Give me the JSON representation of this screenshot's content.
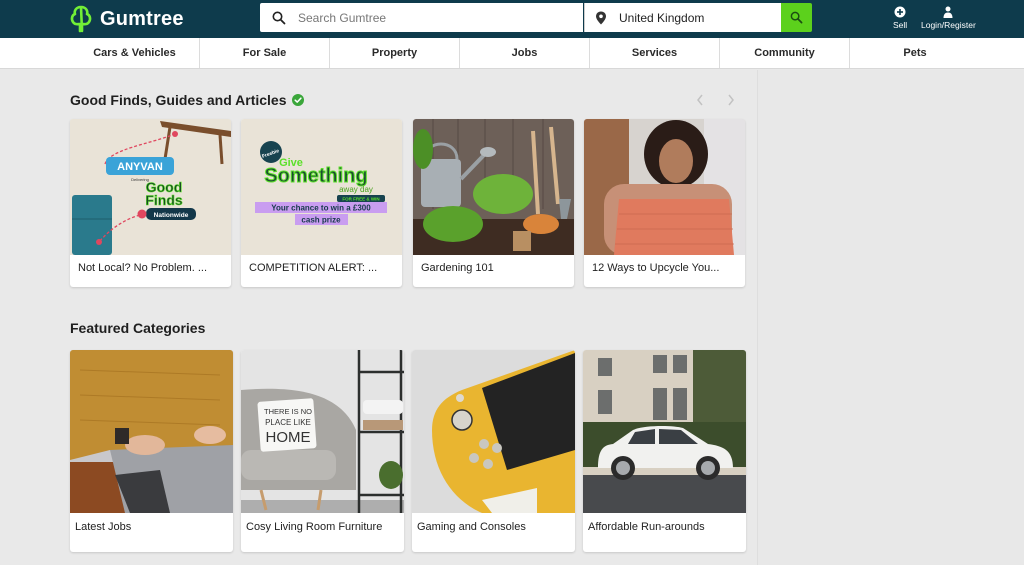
{
  "header": {
    "logo_text": "Gumtree",
    "search_placeholder": "Search Gumtree",
    "location_value": "United Kingdom",
    "sell_label": "Sell",
    "login_label": "Login/Register"
  },
  "categories": [
    {
      "label": "Cars & Vehicles"
    },
    {
      "label": "For Sale"
    },
    {
      "label": "Property"
    },
    {
      "label": "Jobs"
    },
    {
      "label": "Services"
    },
    {
      "label": "Community"
    },
    {
      "label": "Pets"
    }
  ],
  "good_finds": {
    "title": "Good Finds, Guides and Articles",
    "cards": [
      {
        "title": "Not Local? No Problem. ...",
        "image": "anyvan-good-finds-nationwide"
      },
      {
        "title": "COMPETITION ALERT: ...",
        "image": "give-something-away-day-promo"
      },
      {
        "title": "Gardening 101",
        "image": "gardening-tools-plants"
      },
      {
        "title": "12 Ways to Upcycle You...",
        "image": "woman-with-knit-sweater"
      }
    ],
    "promo_text": {
      "anyvan": "ANYVAN",
      "delivering": "Delivering",
      "good": "Good",
      "finds": "Finds",
      "nationwide": "Nationwide",
      "freebie": "Freebie",
      "give": "Give",
      "something": "Something",
      "away_day": "away day",
      "free_win": "FOR FREE & WIN",
      "chance_line1": "Your chance to win a £300",
      "chance_line2": "cash prize"
    }
  },
  "featured": {
    "title": "Featured Categories",
    "cards": [
      {
        "title": "Latest Jobs",
        "image": "laptop-typing"
      },
      {
        "title": "Cosy Living Room Furniture",
        "image": "armchair-home-cushion"
      },
      {
        "title": "Gaming and Consoles",
        "image": "yellow-handheld-console"
      },
      {
        "title": "Affordable Run-arounds",
        "image": "white-small-car"
      }
    ],
    "cushion_text": {
      "line1": "THERE IS NO",
      "line2": "PLACE LIKE",
      "line3": "HOME"
    }
  },
  "colors": {
    "header_bg": "#0e3b4c",
    "brand_green": "#5cd11c",
    "check_green": "#3aa63a"
  }
}
